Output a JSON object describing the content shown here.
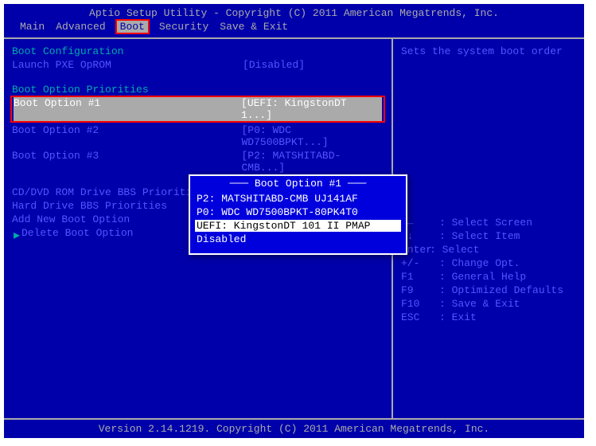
{
  "title": "Aptio Setup Utility - Copyright (C) 2011 American Megatrends, Inc.",
  "tabs": [
    "Main",
    "Advanced",
    "Boot",
    "Security",
    "Save & Exit"
  ],
  "sections": {
    "boot_config": "Boot Configuration",
    "pxe_label": "Launch PXE OpROM",
    "pxe_val": "[Disabled]",
    "priorities": "Boot Option Priorities",
    "opt1_label": "Boot Option #1",
    "opt1_val": "[UEFI: KingstonDT 1...]",
    "opt2_label": "Boot Option #2",
    "opt2_val": "[P0: WDC WD7500BPKT...]",
    "opt3_label": "Boot Option #3",
    "opt3_val": "[P2: MATSHITABD-CMB...]",
    "menu1": "CD/DVD ROM Drive BBS Priorities",
    "menu2": "Hard Drive BBS Priorities",
    "menu3": "Add New Boot Option",
    "menu4": "Delete Boot Option"
  },
  "help": {
    "desc": "Sets the system boot order",
    "k1": "→←",
    "v1": ": Select Screen",
    "k2": "↑↓",
    "v2": ": Select Item",
    "k3": "Enter",
    "v3": ": Select",
    "k4": "+/-",
    "v4": ": Change Opt.",
    "k5": "F1",
    "v5": ": General Help",
    "k6": "F9",
    "v6": ": Optimized Defaults",
    "k7": "F10",
    "v7": ": Save & Exit",
    "k8": "ESC",
    "v8": ": Exit"
  },
  "popup": {
    "title": "Boot Option #1",
    "i1": "P2: MATSHITABD-CMB UJ141AF",
    "i2": "P0: WDC WD7500BPKT-80PK4T0",
    "i3": "UEFI: KingstonDT 101 II PMAP",
    "i4": "Disabled"
  },
  "footer": "Version 2.14.1219. Copyright (C) 2011 American Megatrends, Inc."
}
